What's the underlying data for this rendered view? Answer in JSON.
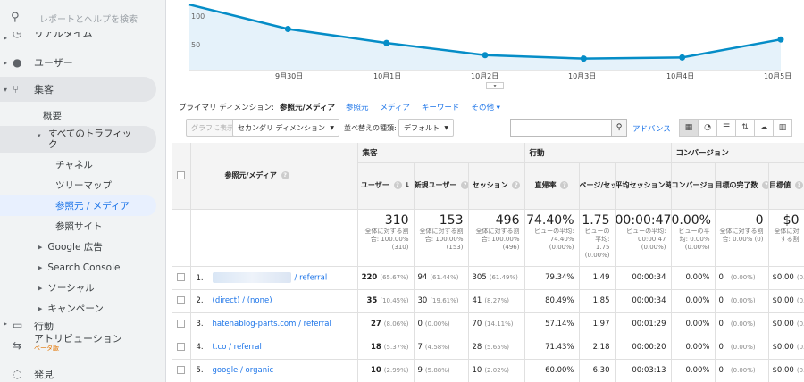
{
  "sidebar": {
    "search_placeholder": "レポートとヘルプを検索",
    "top_cut": "リアルタイム",
    "users": "ユーザー",
    "acquisition": "集客",
    "overview": "概要",
    "all_traffic": "すべてのトラフィック",
    "channels": "チャネル",
    "treemap": "ツリーマップ",
    "source_medium": "参照元 / メディア",
    "referrals": "参照サイト",
    "google_ads": "Google 広告",
    "search_console": "Search Console",
    "social": "ソーシャル",
    "campaigns": "キャンペーン",
    "behavior_cut": "行動",
    "attribution": "アトリビューション",
    "beta": "ベータ版",
    "discover": "発見"
  },
  "chart": {
    "y_labels": [
      "100",
      "50"
    ],
    "x_labels": [
      "9月30日",
      "10月1日",
      "10月2日",
      "10月3日",
      "10月4日",
      "10月5日"
    ],
    "color": "#058dc7",
    "fill": "#e5f2fa"
  },
  "chart_data": {
    "type": "area",
    "x": [
      "9月29日",
      "9月30日",
      "10月1日",
      "10月2日",
      "10月3日",
      "10月4日",
      "10月5日"
    ],
    "values": [
      142,
      100,
      76,
      55,
      49,
      51,
      82
    ],
    "ylim": [
      30,
      150
    ],
    "y_ticks": [
      50,
      100
    ],
    "grid": true
  },
  "dimension": {
    "label": "プライマリ ディメンション:",
    "selected": "参照元/メディア",
    "options": [
      "参照元",
      "メディア",
      "キーワード",
      "その他 ▾"
    ]
  },
  "toolbar": {
    "plot_rows": "グラフに表示",
    "secondary_dim": "セカンダリ ディメンション",
    "sort_label": "並べ替えの種類:",
    "sort_value": "デフォルト",
    "advanced": "アドバンス"
  },
  "table": {
    "groups": {
      "acquisition": "集客",
      "behavior": "行動",
      "conversion": "コンバージョン"
    },
    "headers": {
      "dimension": "参照元/メディア",
      "users": "ユーザー",
      "new_users": "新規ユーザー",
      "sessions": "セッション",
      "bounce": "直帰率",
      "pages": "ページ/セッション",
      "duration": "平均セッション時間",
      "conv_rate": "コンバージョン率",
      "goal_comp": "目標の完了数",
      "goal_value": "目標値"
    },
    "totals": {
      "users": "310",
      "users_sub": "全体に対する割合: 100.00% (310)",
      "new_users": "153",
      "new_users_sub": "全体に対する割合: 100.00% (153)",
      "sessions": "496",
      "sessions_sub": "全体に対する割合: 100.00% (496)",
      "bounce": "74.40%",
      "bounce_sub": "ビューの平均: 74.40% (0.00%)",
      "pages": "1.75",
      "pages_sub": "ビューの平均: 1.75 (0.00%)",
      "duration": "00:00:47",
      "duration_sub": "ビューの平均: 00:00:47 (0.00%)",
      "conv_rate": "0.00%",
      "conv_rate_sub": "ビューの平均: 0.00% (0.00%)",
      "goal_comp": "0",
      "goal_comp_sub": "全体に対する割合: 0.00% (0)",
      "goal_value": "$0",
      "goal_value_sub": "全体に対する割"
    },
    "rows": [
      {
        "idx": "1.",
        "src": "/ referral",
        "users": "220",
        "users_pct": "(65.67%)",
        "new": "94",
        "new_pct": "(61.44%)",
        "sess": "305",
        "sess_pct": "(61.49%)",
        "bounce": "79.34%",
        "pages": "1.49",
        "dur": "00:00:34",
        "conv": "0.00%",
        "goal": "0",
        "goal_pct": "(0.00%)",
        "val": "$0.00",
        "val_pct": "(0.00"
      },
      {
        "idx": "2.",
        "src": "(direct) / (none)",
        "users": "35",
        "users_pct": "(10.45%)",
        "new": "30",
        "new_pct": "(19.61%)",
        "sess": "41",
        "sess_pct": "(8.27%)",
        "bounce": "80.49%",
        "pages": "1.85",
        "dur": "00:00:34",
        "conv": "0.00%",
        "goal": "0",
        "goal_pct": "(0.00%)",
        "val": "$0.00",
        "val_pct": "(0.00"
      },
      {
        "idx": "3.",
        "src": "hatenablog-parts.com / referral",
        "users": "27",
        "users_pct": "(8.06%)",
        "new": "0",
        "new_pct": "(0.00%)",
        "sess": "70",
        "sess_pct": "(14.11%)",
        "bounce": "57.14%",
        "pages": "1.97",
        "dur": "00:01:29",
        "conv": "0.00%",
        "goal": "0",
        "goal_pct": "(0.00%)",
        "val": "$0.00",
        "val_pct": "(0.00"
      },
      {
        "idx": "4.",
        "src": "t.co / referral",
        "users": "18",
        "users_pct": "(5.37%)",
        "new": "7",
        "new_pct": "(4.58%)",
        "sess": "28",
        "sess_pct": "(5.65%)",
        "bounce": "71.43%",
        "pages": "2.18",
        "dur": "00:00:20",
        "conv": "0.00%",
        "goal": "0",
        "goal_pct": "(0.00%)",
        "val": "$0.00",
        "val_pct": "(0.00"
      },
      {
        "idx": "5.",
        "src": "google / organic",
        "users": "10",
        "users_pct": "(2.99%)",
        "new": "9",
        "new_pct": "(5.88%)",
        "sess": "10",
        "sess_pct": "(2.02%)",
        "bounce": "60.00%",
        "pages": "6.30",
        "dur": "00:03:13",
        "conv": "0.00%",
        "goal": "0",
        "goal_pct": "(0.00%)",
        "val": "$0.00",
        "val_pct": "(0.00"
      }
    ]
  }
}
